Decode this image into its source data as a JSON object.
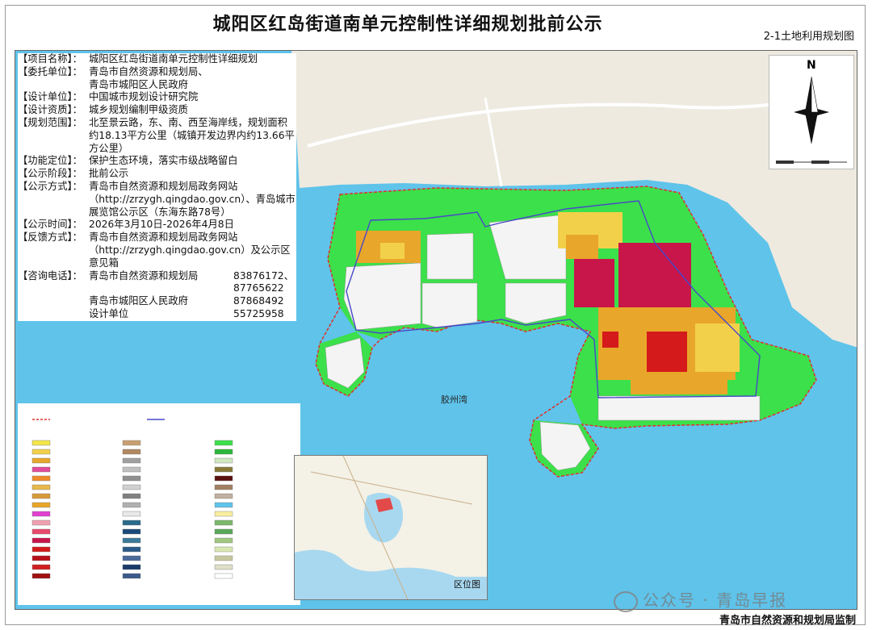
{
  "title": "城阳区红岛街道南单元控制性详细规划批前公示",
  "subtitle": "2-1土地利用规划图",
  "info": [
    {
      "key": "【项目名称】：",
      "value": "城阳区红岛街道南单元控制性详细规划"
    },
    {
      "key": "【委托单位】：",
      "value": "青岛市自然资源和规划局、\n青岛市城阳区人民政府"
    },
    {
      "key": "【设计单位】：",
      "value": "中国城市规划设计研究院"
    },
    {
      "key": "【设计资质】：",
      "value": "城乡规划编制甲级资质"
    },
    {
      "key": "【规划范围】：",
      "value": "北至景云路，东、南、西至海岸线，规划面积约18.13平方公里（城镇开发边界内约13.66平方公里）"
    },
    {
      "key": "【功能定位】：",
      "value": "保护生态环境，落实市级战略留白"
    },
    {
      "key": "【公示阶段】：",
      "value": "批前公示"
    },
    {
      "key": "【公示方式】：",
      "value": "青岛市自然资源和规划局政务网站（http://zrzygh.qingdao.gov.cn）、青岛城市展览馆公示区（东海东路78号）"
    },
    {
      "key": "【公示时间】：",
      "value": "2026年3月10日-2026年4月8日"
    },
    {
      "key": "【反馈方式】：",
      "value": "青岛市自然资源和规划局政务网站（http://zrzygh.qingdao.gov.cn）及公示区意见箱"
    }
  ],
  "contact": {
    "key": "【咨询电话】：",
    "rows": [
      {
        "name": "青岛市自然资源和规划局",
        "phone": "83876172、\n87765622"
      },
      {
        "name": "青岛市城阳区人民政府",
        "phone": "87868492"
      },
      {
        "name": "设计单位",
        "phone": "55725958"
      }
    ]
  },
  "north_label": "N",
  "bay_label": "胶州湾",
  "inset_label": "区位图",
  "watermark": "公众号 · 青岛早报",
  "footer": "青岛市自然资源和规划局监制",
  "colors": {
    "sea": "#5fc3ea",
    "green": "#3be04a",
    "residential": "#e8a62a",
    "commercial": "#c8154a",
    "white_land": "#f4f4f4",
    "boundary": "#e0302a",
    "dev_boundary": "#4848c8"
  }
}
